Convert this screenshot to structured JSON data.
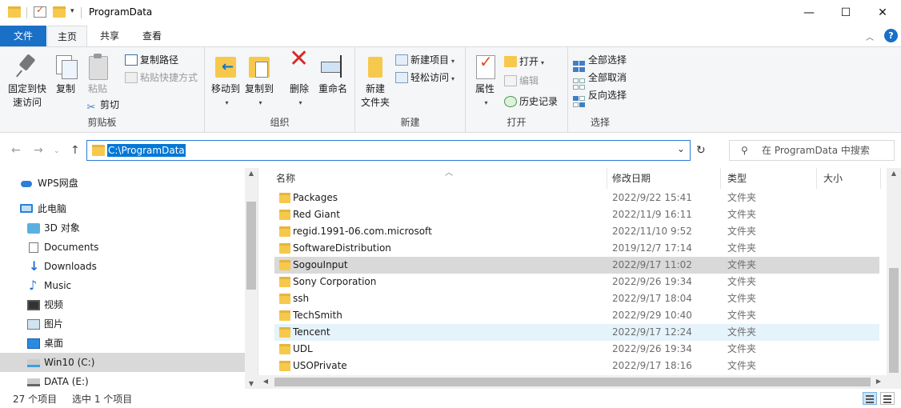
{
  "window": {
    "title": "ProgramData",
    "minimize": "—",
    "maximize": "☐",
    "close": "✕"
  },
  "tabs": [
    {
      "label": "文件"
    },
    {
      "label": "主页"
    },
    {
      "label": "共享"
    },
    {
      "label": "查看"
    }
  ],
  "ribbon": {
    "clipboard": {
      "label": "剪贴板",
      "pin": "固定到快\n速访问",
      "pin_line1": "固定到快",
      "pin_line2": "速访问",
      "copy": "复制",
      "paste": "粘贴",
      "copy_path": "复制路径",
      "paste_shortcut": "粘贴快捷方式",
      "cut": "剪切"
    },
    "organize": {
      "label": "组织",
      "move_to": "移动到",
      "copy_to": "复制到",
      "delete": "删除",
      "rename": "重命名"
    },
    "new": {
      "label": "新建",
      "new_folder_line1": "新建",
      "new_folder_line2": "文件夹",
      "new_item": "新建项目",
      "easy_access": "轻松访问"
    },
    "open": {
      "label": "打开",
      "properties": "属性",
      "open": "打开",
      "edit": "编辑",
      "history": "历史记录"
    },
    "select": {
      "label": "选择",
      "select_all": "全部选择",
      "select_none": "全部取消",
      "invert": "反向选择"
    }
  },
  "address": {
    "path": "C:\\ProgramData",
    "search_placeholder": "在 ProgramData 中搜索"
  },
  "navpane": {
    "items": [
      {
        "label": "WPS网盘"
      },
      {
        "label": "此电脑"
      },
      {
        "label": "3D 对象"
      },
      {
        "label": "Documents"
      },
      {
        "label": "Downloads"
      },
      {
        "label": "Music"
      },
      {
        "label": "视频"
      },
      {
        "label": "图片"
      },
      {
        "label": "桌面"
      },
      {
        "label": "Win10 (C:)"
      },
      {
        "label": "DATA (E:)"
      }
    ]
  },
  "columns": {
    "name": "名称",
    "date": "修改日期",
    "type": "类型",
    "size": "大小"
  },
  "files": [
    {
      "name": "Packages",
      "date": "2022/9/22 15:41",
      "type": "文件夹"
    },
    {
      "name": "Red Giant",
      "date": "2022/11/9 16:11",
      "type": "文件夹"
    },
    {
      "name": "regid.1991-06.com.microsoft",
      "date": "2022/11/10 9:52",
      "type": "文件夹"
    },
    {
      "name": "SoftwareDistribution",
      "date": "2019/12/7 17:14",
      "type": "文件夹"
    },
    {
      "name": "SogouInput",
      "date": "2022/9/17 11:02",
      "type": "文件夹"
    },
    {
      "name": "Sony Corporation",
      "date": "2022/9/26 19:34",
      "type": "文件夹"
    },
    {
      "name": "ssh",
      "date": "2022/9/17 18:04",
      "type": "文件夹"
    },
    {
      "name": "TechSmith",
      "date": "2022/9/29 10:40",
      "type": "文件夹"
    },
    {
      "name": "Tencent",
      "date": "2022/9/17 12:24",
      "type": "文件夹"
    },
    {
      "name": "UDL",
      "date": "2022/9/26 19:34",
      "type": "文件夹"
    },
    {
      "name": "USOPrivate",
      "date": "2022/9/17 18:16",
      "type": "文件夹"
    }
  ],
  "status": {
    "count": "27 个项目",
    "selected": "选中 1 个项目"
  },
  "colors": {
    "accent": "#1a6fc6",
    "folder": "#f6c94d",
    "selection": "#d9d9d9",
    "hover": "#e5f3fb"
  }
}
